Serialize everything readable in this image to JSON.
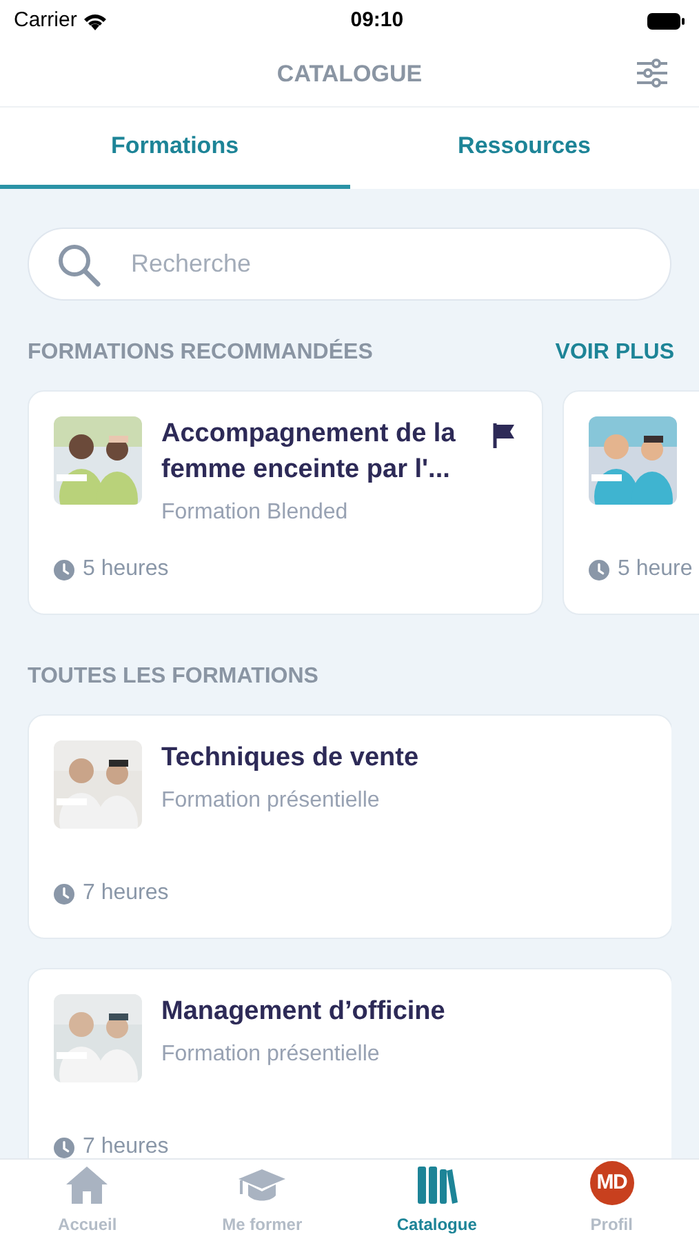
{
  "status_bar": {
    "carrier": "Carrier",
    "time": "09:10"
  },
  "header": {
    "title": "CATALOGUE"
  },
  "tabs": [
    {
      "label": "Formations",
      "selected": true
    },
    {
      "label": "Ressources",
      "selected": false
    }
  ],
  "search": {
    "placeholder": "Recherche"
  },
  "recommended": {
    "title": "FORMATIONS RECOMMANDÉES",
    "more": "VOIR PLUS",
    "cards": [
      {
        "kind": "picture",
        "title": "Accompagnement de la femme enceinte par l'...",
        "subtitle": "Formation Blended",
        "duration": "5 heures",
        "flagged": true
      },
      {
        "kind": "picture",
        "duration": "5 heure"
      }
    ]
  },
  "all": {
    "title": "TOUTES LES FORMATIONS",
    "cards": [
      {
        "kind": "picture",
        "title": "Techniques de vente",
        "subtitle": "Formation présentielle",
        "duration": "7 heures"
      },
      {
        "kind": "picture",
        "title": "Management d’officine",
        "subtitle": "Formation présentielle",
        "duration": "7 heures"
      }
    ]
  },
  "nav": [
    {
      "kind": "home",
      "label": "Accueil",
      "selected": false
    },
    {
      "kind": "cap",
      "label": "Me former",
      "selected": false
    },
    {
      "kind": "books",
      "label": "Catalogue",
      "selected": true
    },
    {
      "kind": "avatar",
      "label": "Profil",
      "initials": "MD",
      "selected": false
    }
  ]
}
